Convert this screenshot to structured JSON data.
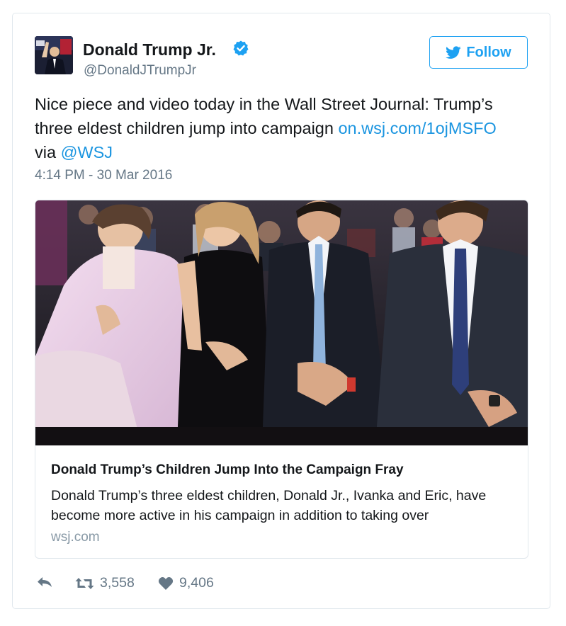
{
  "author": {
    "name": "Donald Trump Jr.",
    "handle": "@DonaldJTrumpJr",
    "verified": true,
    "avatar": "profile-photo"
  },
  "follow_button": {
    "label": "Follow",
    "icon": "twitter-bird-icon"
  },
  "tweet": {
    "text_line1": "Nice piece and video today in the Wall Street Journal: Trump’s",
    "text_line2_prefix": "three eldest children jump into campaign ",
    "link": "on.wsj.com/1ojMSFO",
    "via_prefix": "via ",
    "mention": "@WSJ",
    "timestamp": "4:14 PM - 30 Mar 2016"
  },
  "card": {
    "image": "photo-of-four-people-seated-at-event",
    "title": "Donald Trump’s Children Jump Into the Campaign Fray",
    "description": "Donald Trump’s three eldest children, Donald Jr., Ivanka and Eric, have become more active in his campaign in addition to taking over",
    "domain": "wsj.com"
  },
  "actions": {
    "reply_icon": "reply-icon",
    "retweet_icon": "retweet-icon",
    "retweet_count": "3,558",
    "like_icon": "heart-icon",
    "like_count": "9,406"
  },
  "colors": {
    "accent": "#1da1f2",
    "link": "#1b95e0",
    "secondary_text": "#657786",
    "border": "#e1e8ed"
  }
}
